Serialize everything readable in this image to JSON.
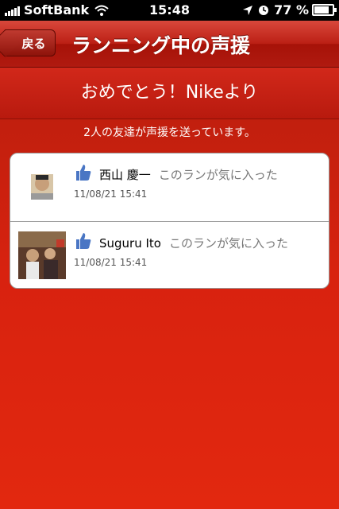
{
  "status_bar": {
    "carrier": "SoftBank",
    "time": "15:48",
    "battery_text": "77 %"
  },
  "nav": {
    "back_label": "戻る",
    "title": "ランニング中の声援"
  },
  "banner": {
    "message": "おめでとう！Nikeより"
  },
  "cheer_count_text": "2人の友達が声援を送っています。",
  "cheers": [
    {
      "name": "西山 慶一",
      "action": "このランが気に入った",
      "timestamp": "11/08/21  15:41"
    },
    {
      "name": "Suguru Ito",
      "action": "このランが気に入った",
      "timestamp": "11/08/21  15:41"
    }
  ],
  "colors": {
    "accent": "#c8200f",
    "like_blue": "#4a76c4"
  }
}
